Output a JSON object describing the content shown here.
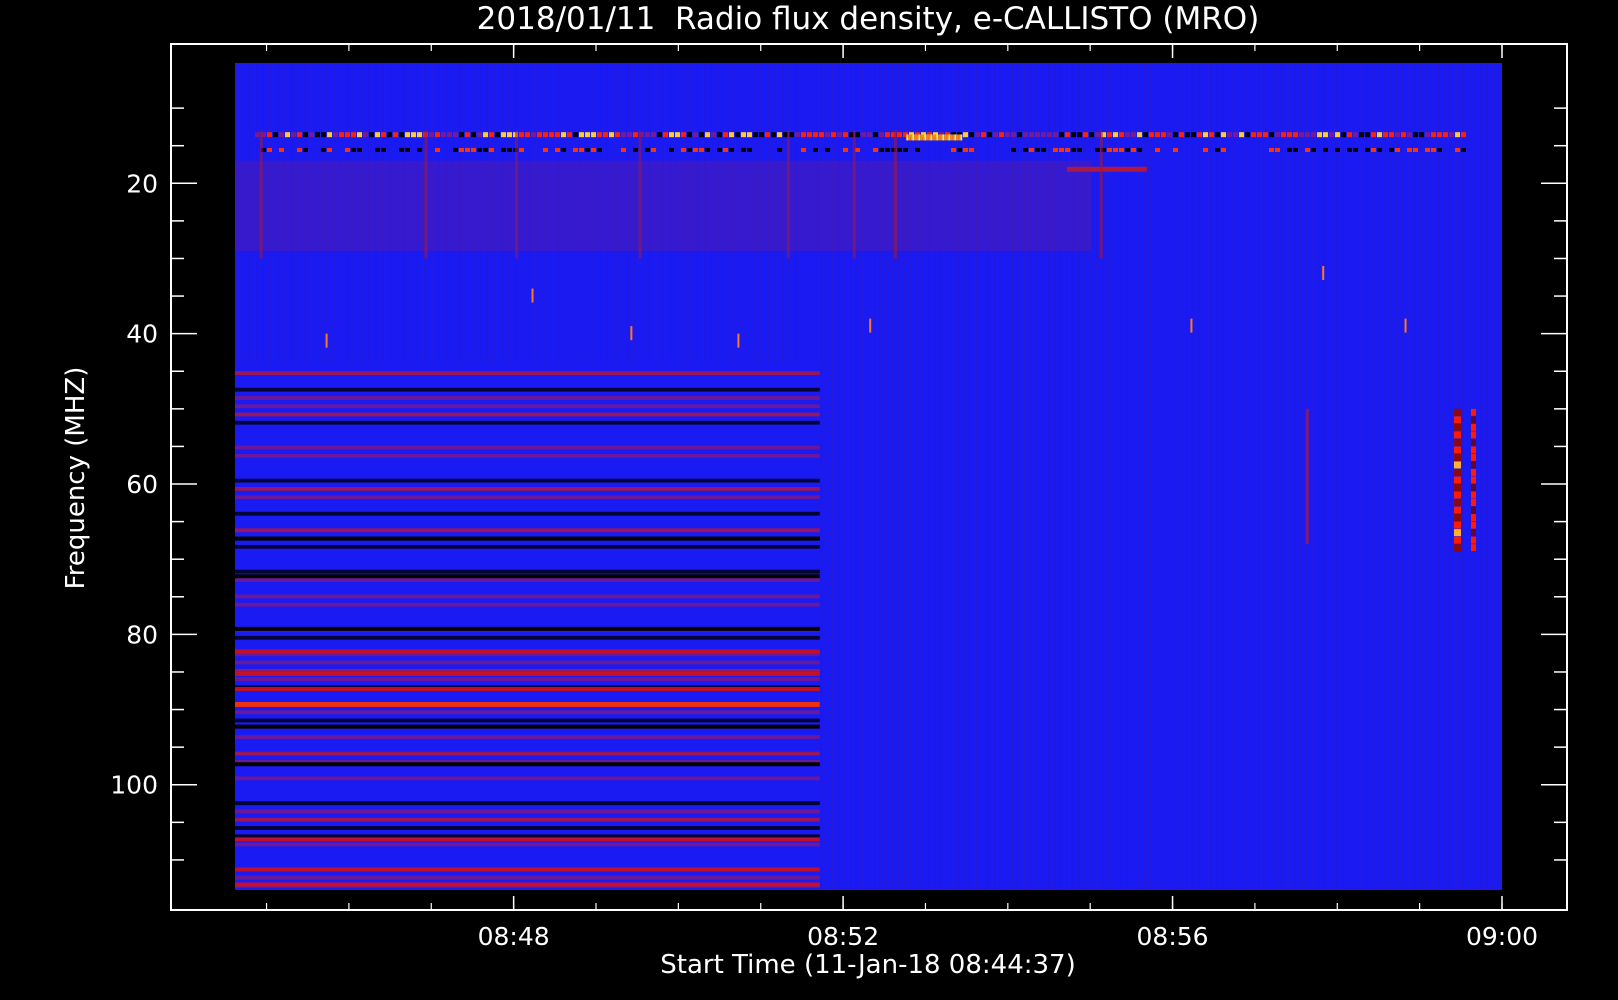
{
  "chart_data": {
    "type": "heatmap",
    "title": "2018/01/11  Radio flux density, e-CALLISTO (MRO)",
    "xlabel": "Start Time (11-Jan-18 08:44:37)",
    "ylabel": "Frequency (MHZ)",
    "x_range": [
      "08:44:37",
      "09:00:00"
    ],
    "y_range": [
      4,
      114
    ],
    "y_reversed": true,
    "x_ticks": [
      "08:48",
      "08:52",
      "08:56",
      "09:00"
    ],
    "x_tick_minutes": [
      3.383,
      7.383,
      11.383,
      15.383
    ],
    "x_total_minutes": 15.383,
    "y_ticks": [
      20,
      40,
      60,
      80,
      100
    ],
    "colormap": [
      "#000000",
      "#0000ff",
      "#ff0000",
      "#ffff66"
    ],
    "colors": {
      "background": "#000000",
      "field": "#1a1af2",
      "axes": "#ffffff"
    },
    "features": [
      {
        "name": "strong interference bands (first segment)",
        "freq_mhz": [
          14,
          16,
          82,
          89,
          107,
          113
        ],
        "time_min": [
          0,
          7.1
        ]
      },
      {
        "name": "dark horizontal bands (first segment)",
        "freq_mhz": [
          67,
          72,
          79,
          92,
          97
        ],
        "time_min": [
          0,
          7.1
        ]
      },
      {
        "name": "burst",
        "freq_mhz": [
          52,
          67
        ],
        "time_min": [
          14.8,
          15.0
        ]
      },
      {
        "name": "low-frequency RFI",
        "freq_mhz": [
          13,
          30
        ],
        "time_min": [
          0,
          15.383
        ]
      }
    ]
  }
}
